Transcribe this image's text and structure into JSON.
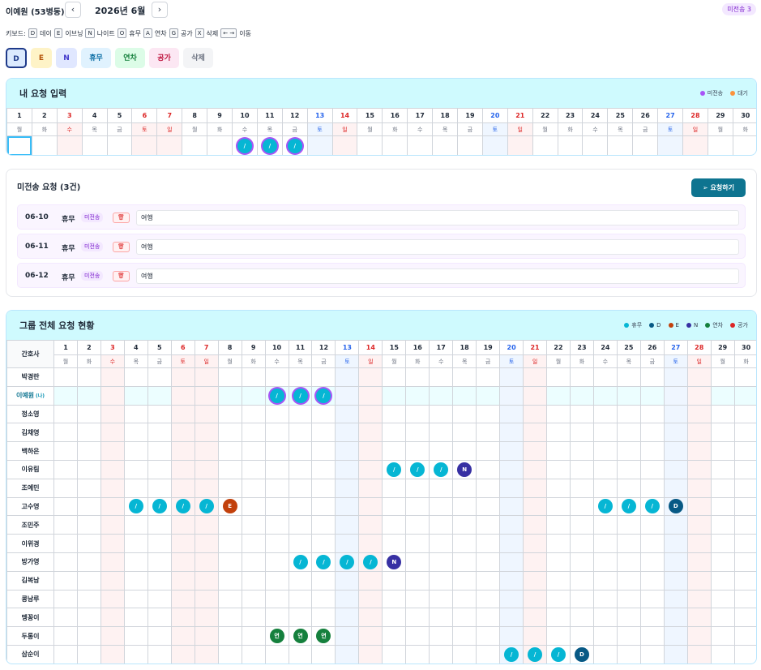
{
  "header": {
    "ward": "이예원 (53병동)",
    "prev": "‹",
    "next": "›",
    "month": "2026년 6월",
    "unsent_badge": "미전송 3"
  },
  "keyboard": {
    "label": "키보드:",
    "items": [
      {
        "key": "D",
        "label": "데이"
      },
      {
        "key": "E",
        "label": "이브닝"
      },
      {
        "key": "N",
        "label": "나이트"
      },
      {
        "key": "O",
        "label": "휴무"
      },
      {
        "key": "A",
        "label": "연차"
      },
      {
        "key": "G",
        "label": "공가"
      },
      {
        "key": "X",
        "label": "삭제"
      },
      {
        "key": "← →",
        "label": "이동"
      }
    ]
  },
  "shift_buttons": [
    {
      "label": "D",
      "bg": "#dbeafe",
      "fg": "#1e3a8a",
      "border": "#1e3a8a",
      "width": 26
    },
    {
      "label": "E",
      "bg": "#fef3c7",
      "fg": "#b45309",
      "border": "#fef3c7",
      "width": 26
    },
    {
      "label": "N",
      "bg": "#e0e7ff",
      "fg": "#4338ca",
      "border": "#e0e7ff",
      "width": 26
    },
    {
      "label": "휴무",
      "bg": "#e0f2fe",
      "fg": "#0369a1",
      "border": "#e0f2fe",
      "width": 37
    },
    {
      "label": "연차",
      "bg": "#dcfce7",
      "fg": "#15803d",
      "border": "#dcfce7",
      "width": 37
    },
    {
      "label": "공가",
      "bg": "#fce7f3",
      "fg": "#be123c",
      "border": "#fce7f3",
      "width": 37
    },
    {
      "label": "삭제",
      "bg": "#f3f4f6",
      "fg": "#6b7280",
      "border": "#f3f4f6",
      "width": 37
    }
  ],
  "my_request": {
    "title": "내 요청 입력",
    "legend": [
      {
        "label": "미전송",
        "color": "#a855f7"
      },
      {
        "label": "대기",
        "color": "#fb923c"
      }
    ]
  },
  "days": [
    "1",
    "2",
    "3",
    "4",
    "5",
    "6",
    "7",
    "8",
    "9",
    "10",
    "11",
    "12",
    "13",
    "14",
    "15",
    "16",
    "17",
    "18",
    "19",
    "20",
    "21",
    "22",
    "23",
    "24",
    "25",
    "26",
    "27",
    "28",
    "29",
    "30"
  ],
  "weekdays": [
    "월",
    "화",
    "수",
    "목",
    "금",
    "토",
    "일",
    "월",
    "화",
    "수",
    "목",
    "금",
    "토",
    "일",
    "월",
    "화",
    "수",
    "목",
    "금",
    "토",
    "일",
    "월",
    "화",
    "수",
    "목",
    "금",
    "토",
    "일",
    "월",
    "화"
  ],
  "red_days": [
    3,
    6,
    7,
    14,
    21,
    28
  ],
  "blue_days": [
    13,
    20,
    27
  ],
  "my_cells": {
    "10": "/",
    "11": "/",
    "12": "/"
  },
  "pending": {
    "title": "미전송 요청 (3건)",
    "submit_label": "요청하기",
    "submit_icon": "send-icon",
    "rows": [
      {
        "date": "06-10",
        "type": "휴무",
        "status": "미전송",
        "note": "여행"
      },
      {
        "date": "06-11",
        "type": "휴무",
        "status": "미전송",
        "note": "여행"
      },
      {
        "date": "06-12",
        "type": "휴무",
        "status": "미전송",
        "note": "여행"
      }
    ]
  },
  "group": {
    "title": "그룹 전체 요청 현황",
    "nurse_header": "간호사",
    "legend": [
      {
        "label": "휴무",
        "color": "#06b6d4"
      },
      {
        "label": "D",
        "color": "#075985"
      },
      {
        "label": "E",
        "color": "#c2410c"
      },
      {
        "label": "N",
        "color": "#3730a3"
      },
      {
        "label": "연차",
        "color": "#15803d"
      },
      {
        "label": "공가",
        "color": "#dc2626"
      }
    ],
    "nurses": [
      {
        "name": "박경란",
        "cells": {}
      },
      {
        "name": "이예원",
        "me": "(나)",
        "cells": {
          "10": "/",
          "11": "/",
          "12": "/"
        }
      },
      {
        "name": "정소영",
        "cells": {}
      },
      {
        "name": "김채영",
        "cells": {}
      },
      {
        "name": "백하은",
        "cells": {}
      },
      {
        "name": "이유림",
        "cells": {
          "15": "/",
          "16": "/",
          "17": "/",
          "18": "N"
        }
      },
      {
        "name": "조예민",
        "cells": {}
      },
      {
        "name": "고수영",
        "cells": {
          "4": "/",
          "5": "/",
          "6": "/",
          "7": "/",
          "8": "E",
          "24": "/",
          "25": "/",
          "26": "/",
          "27": "D"
        }
      },
      {
        "name": "조민주",
        "cells": {}
      },
      {
        "name": "이위경",
        "cells": {}
      },
      {
        "name": "방가영",
        "cells": {
          "11": "/",
          "12": "/",
          "13": "/",
          "14": "/",
          "15": "N"
        }
      },
      {
        "name": "김복남",
        "cells": {}
      },
      {
        "name": "콩남루",
        "cells": {}
      },
      {
        "name": "멩꽁이",
        "cells": {}
      },
      {
        "name": "두롱이",
        "cells": {
          "10": "연",
          "11": "연",
          "12": "연"
        }
      },
      {
        "name": "삼순이",
        "cells": {
          "20": "/",
          "21": "/",
          "22": "/",
          "23": "D"
        }
      }
    ]
  },
  "colors": {
    "/": "#06b6d4",
    "D": "#075985",
    "E": "#c2410c",
    "N": "#3730a3",
    "연": "#15803d",
    "공": "#dc2626",
    "pending_ring": "#a855f7"
  }
}
